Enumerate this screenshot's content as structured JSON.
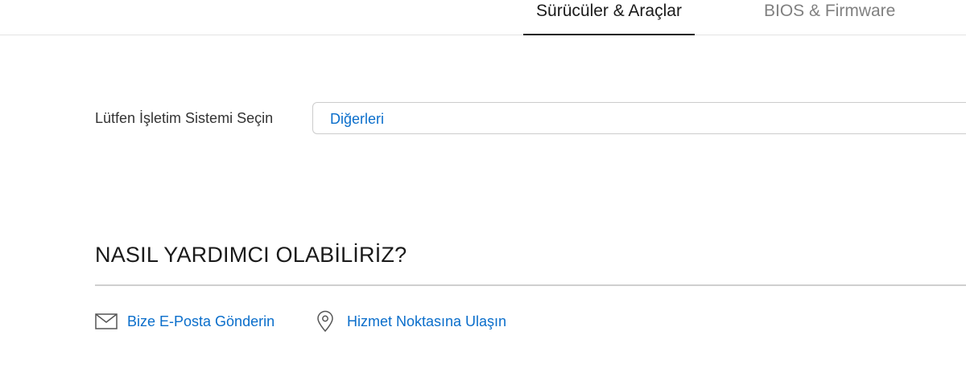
{
  "tabs": [
    {
      "label": "Sürücüler & Araçlar",
      "active": true
    },
    {
      "label": "BIOS & Firmware",
      "active": false
    }
  ],
  "os_selector": {
    "label": "Lütfen İşletim Sistemi Seçin",
    "selected_value": "Diğerleri"
  },
  "help": {
    "title": "NASIL YARDIMCI OLABİLİRİZ?",
    "links": [
      {
        "label": "Bize E-Posta Gönderin",
        "icon": "mail-icon"
      },
      {
        "label": "Hizmet Noktasına Ulaşın",
        "icon": "location-pin-icon"
      }
    ]
  },
  "colors": {
    "accent": "#0a6ecb",
    "text": "#1a1a1a",
    "muted": "#808080",
    "border": "#cccccc"
  }
}
